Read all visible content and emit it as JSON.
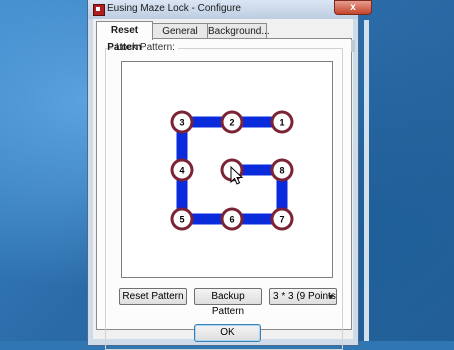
{
  "window": {
    "title": "Eusing Maze Lock - Configure",
    "close_label": "x"
  },
  "tabs": [
    {
      "label": "Reset Pattern",
      "active": true
    },
    {
      "label": "General",
      "active": false
    },
    {
      "label": "Background...",
      "active": false
    }
  ],
  "group": {
    "label": "Lock Pattern:"
  },
  "pattern": {
    "grid": "3 * 3",
    "path_sequence": [
      1,
      2,
      3,
      4,
      5,
      6,
      7,
      8,
      9
    ],
    "nodes": [
      {
        "label": "3"
      },
      {
        "label": "2"
      },
      {
        "label": "1"
      },
      {
        "label": "4"
      },
      {
        "label": ""
      },
      {
        "label": "8"
      },
      {
        "label": "5"
      },
      {
        "label": "6"
      },
      {
        "label": "7"
      }
    ],
    "colors": {
      "stroke": "#0a2bdc",
      "node_fill": "#ffffff",
      "node_ring": "#7a2335"
    }
  },
  "buttons": {
    "reset": "Reset Pattern",
    "backup": "Backup Pattern",
    "points_select": "3 * 3 (9 Points",
    "ok": "OK"
  }
}
